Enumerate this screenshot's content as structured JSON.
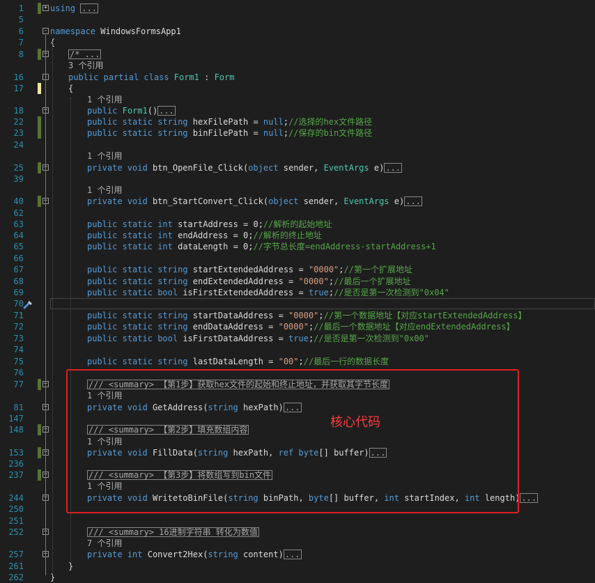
{
  "editor": {
    "lines": [
      {
        "num": "1",
        "fold": "+",
        "segments": [
          {
            "t": "using",
            "c": "kw"
          },
          {
            "t": " "
          },
          {
            "t": "...",
            "c": "coll"
          }
        ],
        "mark": "saved"
      },
      {
        "num": "5",
        "segments": []
      },
      {
        "num": "6",
        "fold": "-",
        "segments": [
          {
            "t": "namespace",
            "c": "kw"
          },
          {
            "t": " WindowsFormsApp1"
          }
        ]
      },
      {
        "num": "7",
        "segments": [
          {
            "t": "{"
          }
        ]
      },
      {
        "num": "8",
        "fold": "+",
        "segments": [
          {
            "t": "/* ...",
            "c": "coll cm"
          }
        ],
        "mark": "saved"
      },
      {
        "num": "",
        "segments": [
          {
            "t": "3 个引用",
            "c": "rf"
          }
        ]
      },
      {
        "num": "16",
        "fold": "-",
        "segments": [
          {
            "t": "public",
            "c": "kw"
          },
          {
            "t": " "
          },
          {
            "t": "partial",
            "c": "kw"
          },
          {
            "t": " "
          },
          {
            "t": "class",
            "c": "kw"
          },
          {
            "t": " "
          },
          {
            "t": "Form1",
            "c": "ty"
          },
          {
            "t": " : "
          },
          {
            "t": "Form",
            "c": "ty"
          }
        ]
      },
      {
        "num": "17",
        "segments": [
          {
            "t": "{"
          }
        ],
        "mark": "unsaved"
      },
      {
        "num": "",
        "segments": [
          {
            "t": "1 个引用",
            "c": "rf"
          }
        ]
      },
      {
        "num": "18",
        "fold": "+",
        "segments": [
          {
            "t": "public",
            "c": "kw"
          },
          {
            "t": " "
          },
          {
            "t": "Form1",
            "c": "ty"
          },
          {
            "t": "()"
          },
          {
            "t": "...",
            "c": "coll"
          }
        ]
      },
      {
        "num": "22",
        "segments": [
          {
            "t": "public",
            "c": "kw"
          },
          {
            "t": " "
          },
          {
            "t": "static",
            "c": "kw"
          },
          {
            "t": " "
          },
          {
            "t": "string",
            "c": "kw"
          },
          {
            "t": " hexFilePath = "
          },
          {
            "t": "null",
            "c": "kw"
          },
          {
            "t": ";"
          },
          {
            "t": "//选择的hex文件路径",
            "c": "cm"
          }
        ],
        "mark": "saved"
      },
      {
        "num": "23",
        "segments": [
          {
            "t": "public",
            "c": "kw"
          },
          {
            "t": " "
          },
          {
            "t": "static",
            "c": "kw"
          },
          {
            "t": " "
          },
          {
            "t": "string",
            "c": "kw"
          },
          {
            "t": " binFilePath = "
          },
          {
            "t": "null",
            "c": "kw"
          },
          {
            "t": ";"
          },
          {
            "t": "//保存的bin文件路径",
            "c": "cm"
          }
        ],
        "mark": "saved"
      },
      {
        "num": "24",
        "segments": []
      },
      {
        "num": "",
        "segments": [
          {
            "t": "1 个引用",
            "c": "rf"
          }
        ]
      },
      {
        "num": "25",
        "fold": "+",
        "segments": [
          {
            "t": "private",
            "c": "kw"
          },
          {
            "t": " "
          },
          {
            "t": "void",
            "c": "kw"
          },
          {
            "t": " btn_OpenFile_Click("
          },
          {
            "t": "object",
            "c": "kw"
          },
          {
            "t": " sender, "
          },
          {
            "t": "EventArgs",
            "c": "ty"
          },
          {
            "t": " e)"
          },
          {
            "t": "...",
            "c": "coll"
          }
        ],
        "mark": "saved"
      },
      {
        "num": "39",
        "segments": []
      },
      {
        "num": "",
        "segments": [
          {
            "t": "1 个引用",
            "c": "rf"
          }
        ]
      },
      {
        "num": "40",
        "fold": "+",
        "segments": [
          {
            "t": "private",
            "c": "kw"
          },
          {
            "t": " "
          },
          {
            "t": "void",
            "c": "kw"
          },
          {
            "t": " btn_StartConvert_Click("
          },
          {
            "t": "object",
            "c": "kw"
          },
          {
            "t": " sender, "
          },
          {
            "t": "EventArgs",
            "c": "ty"
          },
          {
            "t": " e)"
          },
          {
            "t": "...",
            "c": "coll"
          }
        ],
        "mark": "saved"
      },
      {
        "num": "62",
        "segments": []
      },
      {
        "num": "63",
        "segments": [
          {
            "t": "public",
            "c": "kw"
          },
          {
            "t": " "
          },
          {
            "t": "static",
            "c": "kw"
          },
          {
            "t": " "
          },
          {
            "t": "int",
            "c": "kw"
          },
          {
            "t": " startAddress = 0;"
          },
          {
            "t": "//解析的起始地址",
            "c": "cm"
          }
        ]
      },
      {
        "num": "64",
        "segments": [
          {
            "t": "public",
            "c": "kw"
          },
          {
            "t": " "
          },
          {
            "t": "static",
            "c": "kw"
          },
          {
            "t": " "
          },
          {
            "t": "int",
            "c": "kw"
          },
          {
            "t": " endAddress = 0;"
          },
          {
            "t": "//解析的终止地址",
            "c": "cm"
          }
        ]
      },
      {
        "num": "65",
        "segments": [
          {
            "t": "public",
            "c": "kw"
          },
          {
            "t": " "
          },
          {
            "t": "static",
            "c": "kw"
          },
          {
            "t": " "
          },
          {
            "t": "int",
            "c": "kw"
          },
          {
            "t": " dataLength = 0;"
          },
          {
            "t": "//字节总长度=endAddress-startAddress+1",
            "c": "cm"
          }
        ]
      },
      {
        "num": "66",
        "segments": []
      },
      {
        "num": "67",
        "segments": [
          {
            "t": "public",
            "c": "kw"
          },
          {
            "t": " "
          },
          {
            "t": "static",
            "c": "kw"
          },
          {
            "t": " "
          },
          {
            "t": "string",
            "c": "kw"
          },
          {
            "t": " startExtendedAddress = "
          },
          {
            "t": "\"0000\"",
            "c": "st"
          },
          {
            "t": ";"
          },
          {
            "t": "//第一个扩展地址",
            "c": "cm"
          }
        ]
      },
      {
        "num": "68",
        "segments": [
          {
            "t": "public",
            "c": "kw"
          },
          {
            "t": " "
          },
          {
            "t": "static",
            "c": "kw"
          },
          {
            "t": " "
          },
          {
            "t": "string",
            "c": "kw"
          },
          {
            "t": " endExtendedAddress = "
          },
          {
            "t": "\"0000\"",
            "c": "st"
          },
          {
            "t": ";"
          },
          {
            "t": "//最后一个扩展地址",
            "c": "cm"
          }
        ]
      },
      {
        "num": "69",
        "segments": [
          {
            "t": "public",
            "c": "kw"
          },
          {
            "t": " "
          },
          {
            "t": "static",
            "c": "kw"
          },
          {
            "t": " "
          },
          {
            "t": "bool",
            "c": "kw"
          },
          {
            "t": " isFirstExtendedAddress = "
          },
          {
            "t": "true",
            "c": "kw"
          },
          {
            "t": ";"
          },
          {
            "t": "//是否是第一次检测到\"0x04\"",
            "c": "cm"
          }
        ]
      },
      {
        "num": "70",
        "segments": [],
        "current": true
      },
      {
        "num": "71",
        "segments": [
          {
            "t": "public",
            "c": "kw"
          },
          {
            "t": " "
          },
          {
            "t": "static",
            "c": "kw"
          },
          {
            "t": " "
          },
          {
            "t": "string",
            "c": "kw"
          },
          {
            "t": " startDataAddress = "
          },
          {
            "t": "\"0000\"",
            "c": "st"
          },
          {
            "t": ";"
          },
          {
            "t": "//第一个数据地址【对应startExtendedAddress】",
            "c": "cm"
          }
        ]
      },
      {
        "num": "72",
        "segments": [
          {
            "t": "public",
            "c": "kw"
          },
          {
            "t": " "
          },
          {
            "t": "static",
            "c": "kw"
          },
          {
            "t": " "
          },
          {
            "t": "string",
            "c": "kw"
          },
          {
            "t": " endDataAddress = "
          },
          {
            "t": "\"0000\"",
            "c": "st"
          },
          {
            "t": ";"
          },
          {
            "t": "//最后一个数据地址【对应endExtendedAddress】",
            "c": "cm"
          }
        ]
      },
      {
        "num": "73",
        "segments": [
          {
            "t": "public",
            "c": "kw"
          },
          {
            "t": " "
          },
          {
            "t": "static",
            "c": "kw"
          },
          {
            "t": " "
          },
          {
            "t": "bool",
            "c": "kw"
          },
          {
            "t": " isFirstDataAddress = "
          },
          {
            "t": "true",
            "c": "kw"
          },
          {
            "t": ";"
          },
          {
            "t": "//是否是第一次检测到\"0x00\"",
            "c": "cm"
          }
        ]
      },
      {
        "num": "74",
        "segments": []
      },
      {
        "num": "75",
        "segments": [
          {
            "t": "public",
            "c": "kw"
          },
          {
            "t": " "
          },
          {
            "t": "static",
            "c": "kw"
          },
          {
            "t": " "
          },
          {
            "t": "string",
            "c": "kw"
          },
          {
            "t": " lastDataLength = "
          },
          {
            "t": "\"00\"",
            "c": "st"
          },
          {
            "t": ";"
          },
          {
            "t": "//最后一行的数据长度",
            "c": "cm"
          }
        ]
      },
      {
        "num": "76",
        "segments": []
      },
      {
        "num": "77",
        "fold": "+",
        "segments": [
          {
            "t": "/// <summary> 【第1步】获取hex文件的起始和终止地址，并获取其字节长度",
            "c": "coll dc"
          }
        ],
        "mark": "saved"
      },
      {
        "num": "",
        "segments": [
          {
            "t": "1 个引用",
            "c": "rf"
          }
        ]
      },
      {
        "num": "81",
        "fold": "+",
        "segments": [
          {
            "t": "private",
            "c": "kw"
          },
          {
            "t": " "
          },
          {
            "t": "void",
            "c": "kw"
          },
          {
            "t": " GetAddress("
          },
          {
            "t": "string",
            "c": "kw"
          },
          {
            "t": " hexPath)"
          },
          {
            "t": "...",
            "c": "coll"
          }
        ]
      },
      {
        "num": "147",
        "segments": []
      },
      {
        "num": "148",
        "fold": "+",
        "segments": [
          {
            "t": "/// <summary> 【第2步】填充数组内容",
            "c": "coll dc"
          }
        ],
        "mark": "saved"
      },
      {
        "num": "",
        "segments": [
          {
            "t": "1 个引用",
            "c": "rf"
          }
        ]
      },
      {
        "num": "153",
        "fold": "+",
        "segments": [
          {
            "t": "private",
            "c": "kw"
          },
          {
            "t": " "
          },
          {
            "t": "void",
            "c": "kw"
          },
          {
            "t": " FillData("
          },
          {
            "t": "string",
            "c": "kw"
          },
          {
            "t": " hexPath, "
          },
          {
            "t": "ref",
            "c": "kw"
          },
          {
            "t": " "
          },
          {
            "t": "byte",
            "c": "kw"
          },
          {
            "t": "[] buffer)"
          },
          {
            "t": "...",
            "c": "coll"
          }
        ],
        "mark": "saved"
      },
      {
        "num": "236",
        "segments": []
      },
      {
        "num": "237",
        "fold": "+",
        "segments": [
          {
            "t": "/// <summary> 【第3步】将数组写到bin文件",
            "c": "coll dc"
          }
        ],
        "mark": "saved"
      },
      {
        "num": "",
        "segments": [
          {
            "t": "1 个引用",
            "c": "rf"
          }
        ]
      },
      {
        "num": "244",
        "fold": "+",
        "segments": [
          {
            "t": "private",
            "c": "kw"
          },
          {
            "t": " "
          },
          {
            "t": "void",
            "c": "kw"
          },
          {
            "t": " WritetoBinFile("
          },
          {
            "t": "string",
            "c": "kw"
          },
          {
            "t": " binPath, "
          },
          {
            "t": "byte",
            "c": "kw"
          },
          {
            "t": "[] buffer, "
          },
          {
            "t": "int",
            "c": "kw"
          },
          {
            "t": " startIndex, "
          },
          {
            "t": "int",
            "c": "kw"
          },
          {
            "t": " length)"
          },
          {
            "t": "...",
            "c": "coll"
          }
        ]
      },
      {
        "num": "250",
        "segments": []
      },
      {
        "num": "251",
        "segments": []
      },
      {
        "num": "252",
        "fold": "+",
        "segments": [
          {
            "t": "/// <summary> 16进制字符串 转化为数值",
            "c": "coll dc"
          }
        ]
      },
      {
        "num": "",
        "segments": [
          {
            "t": "7 个引用",
            "c": "rf"
          }
        ]
      },
      {
        "num": "257",
        "fold": "+",
        "segments": [
          {
            "t": "private",
            "c": "kw"
          },
          {
            "t": " "
          },
          {
            "t": "int",
            "c": "kw"
          },
          {
            "t": " Convert2Hex("
          },
          {
            "t": "string",
            "c": "kw"
          },
          {
            "t": " content)"
          },
          {
            "t": "...",
            "c": "coll"
          }
        ]
      },
      {
        "num": "261",
        "segments": [
          {
            "t": "}"
          }
        ]
      },
      {
        "num": "262",
        "segments": [
          {
            "t": "}"
          }
        ]
      }
    ]
  },
  "annotation": {
    "label": "核心代码",
    "color": "#ff3c3c"
  },
  "colors": {
    "background": "#1e1e1e",
    "line_numbers": "#2b91af",
    "keyword": "#569cd6",
    "type": "#4ec9b0",
    "string": "#d69d85",
    "comment": "#57a64a"
  }
}
